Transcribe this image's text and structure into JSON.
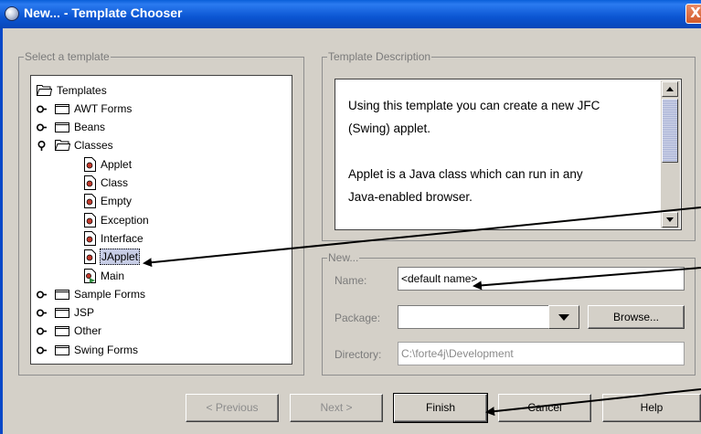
{
  "window": {
    "title": "New... - Template Chooser",
    "close_glyph": "X"
  },
  "left_panel": {
    "legend": "Select a template"
  },
  "tree": {
    "root": "Templates",
    "folders": {
      "awt_forms": "AWT Forms",
      "beans": "Beans",
      "classes": "Classes",
      "sample_forms": "Sample Forms",
      "jsp": "JSP",
      "other": "Other",
      "swing_forms": "Swing Forms"
    },
    "classes_children": {
      "applet": "Applet",
      "class": "Class",
      "empty": "Empty",
      "exception": "Exception",
      "interface": "Interface",
      "japplet": "JApplet",
      "main": "Main"
    },
    "selected": "JApplet"
  },
  "description_panel": {
    "legend": "Template Description",
    "line1": "Using this template you can create a new JFC",
    "line2": "(Swing) applet.",
    "line3": "Applet is a Java class which can run in any",
    "line4": "Java-enabled browser."
  },
  "new_panel": {
    "legend": "New...",
    "name_label": "Name:",
    "name_value": "<default name>",
    "package_label": "Package:",
    "package_value": "",
    "browse_label": "Browse...",
    "directory_label": "Directory:",
    "directory_value": "C:\\forte4j\\Development"
  },
  "buttons": {
    "previous": "< Previous",
    "next": "Next >",
    "finish": "Finish",
    "cancel": "Cancel",
    "help": "Help"
  },
  "colors": {
    "titlebar": "#0a5fd8",
    "window_bg": "#d4d0c8",
    "disabled_text": "#8c8c8c",
    "scroll_thumb": "#a9b2d6",
    "close_button": "#d25a2a"
  }
}
